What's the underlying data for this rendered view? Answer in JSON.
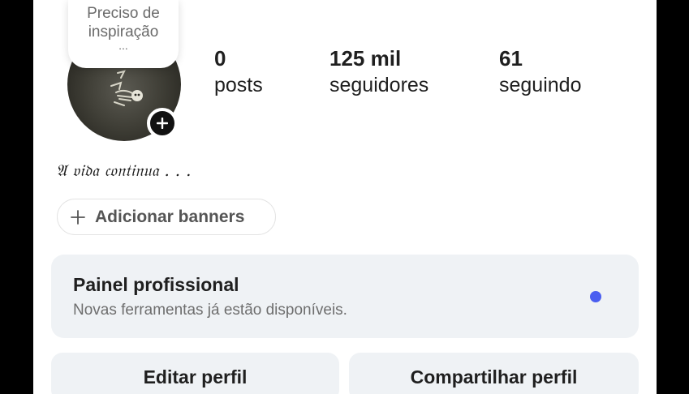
{
  "note": {
    "text": "Preciso de\ninspiração",
    "ellipsis": "..."
  },
  "profile": {
    "avatar_icon": "skeleton-figure-icon",
    "add_story_icon": "plus-icon"
  },
  "stats": [
    {
      "value": "0",
      "label": "posts"
    },
    {
      "value": "125 mil",
      "label": "seguidores"
    },
    {
      "value": "61",
      "label": "seguindo"
    }
  ],
  "bio": "𝔄 𝔳𝔦𝔡𝔞 𝔠𝔬𝔫𝔱𝔦𝔫𝔲𝔞 . . .",
  "banners": {
    "icon": "plus-icon",
    "label": "Adicionar banners"
  },
  "professional_panel": {
    "title": "Painel profissional",
    "subtitle": "Novas ferramentas já estão disponíveis.",
    "dot_color": "#4a5ef0"
  },
  "actions": {
    "edit_label": "Editar perfil",
    "share_label": "Compartilhar perfil"
  },
  "colors": {
    "background": "#ffffff",
    "surface": "#eff2f5",
    "text": "#1f1f1f",
    "muted_text": "#6e6e6e"
  }
}
